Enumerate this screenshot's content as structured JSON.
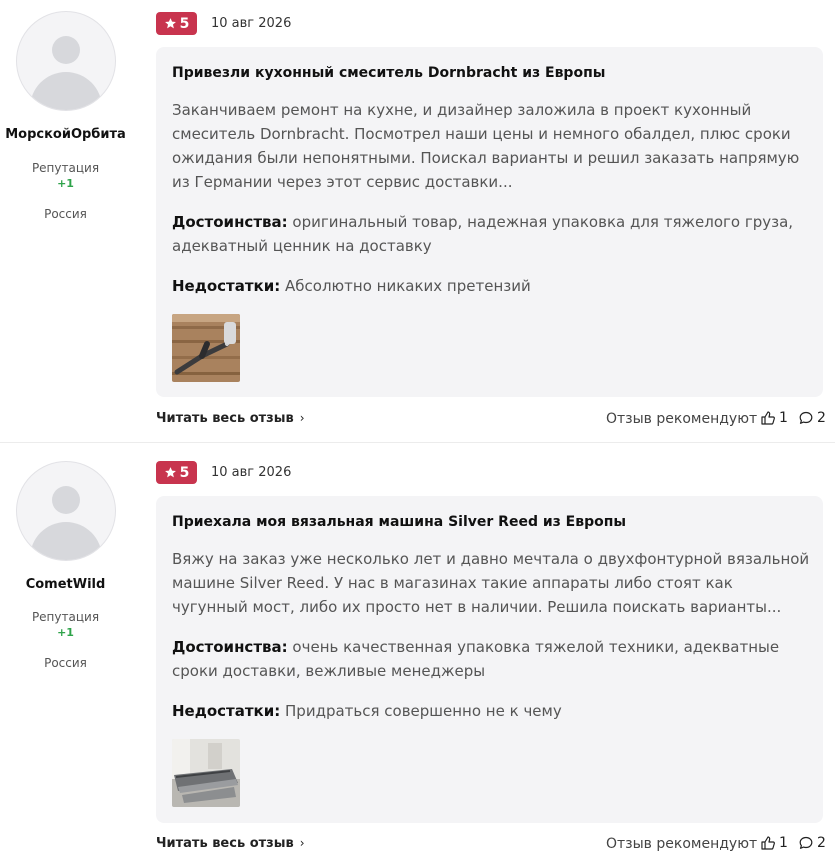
{
  "labels": {
    "reputation": "Репутация",
    "pros": "Достоинства:",
    "cons": "Недостатки:",
    "read_more": "Читать весь отзыв",
    "read_more_chevron": "›",
    "recommend": "Отзыв рекомендуют"
  },
  "colors": {
    "badge": "#c8344e",
    "reputation_positive": "#2ea34a",
    "card_bg": "#f4f4f6"
  },
  "reviews": [
    {
      "author": {
        "name": "МорскойОрбита",
        "reputation": "+1",
        "country": "Россия"
      },
      "rating": "5",
      "date": "10 авг 2026",
      "title": "Привезли кухонный смеситель Dornbracht из Европы",
      "text": "Заканчиваем ремонт на кухне, и дизайнер заложила в проект кухонный смеситель Dornbracht. Посмотрел наши цены и немного обалдел, плюс сроки ожидания были непонятными. Поискал варианты и решил заказать напрямую из Германии через этот сервис доставки...",
      "pros": "оригинальный товар, надежная упаковка для тяжелого груза, адекватный ценник на доставку",
      "cons": "Абсолютно никаких претензий",
      "photo_icon": "faucet-photo",
      "likes": "1",
      "comments": "2"
    },
    {
      "author": {
        "name": "CometWild",
        "reputation": "+1",
        "country": "Россия"
      },
      "rating": "5",
      "date": "10 авг 2026",
      "title": "Приехала моя вязальная машина Silver Reed из Европы",
      "text": "Вяжу на заказ уже несколько лет и давно мечтала о двухфонтурной вязальной машине Silver Reed. У нас в магазинах такие аппараты либо стоят как чугунный мост, либо их просто нет в наличии. Решила поискать варианты...",
      "pros": "очень качественная упаковка тяжелой техники, адекватные сроки доставки, вежливые менеджеры",
      "cons": "Придраться совершенно не к чему",
      "photo_icon": "knitting-machine-photo",
      "likes": "1",
      "comments": "2"
    }
  ]
}
